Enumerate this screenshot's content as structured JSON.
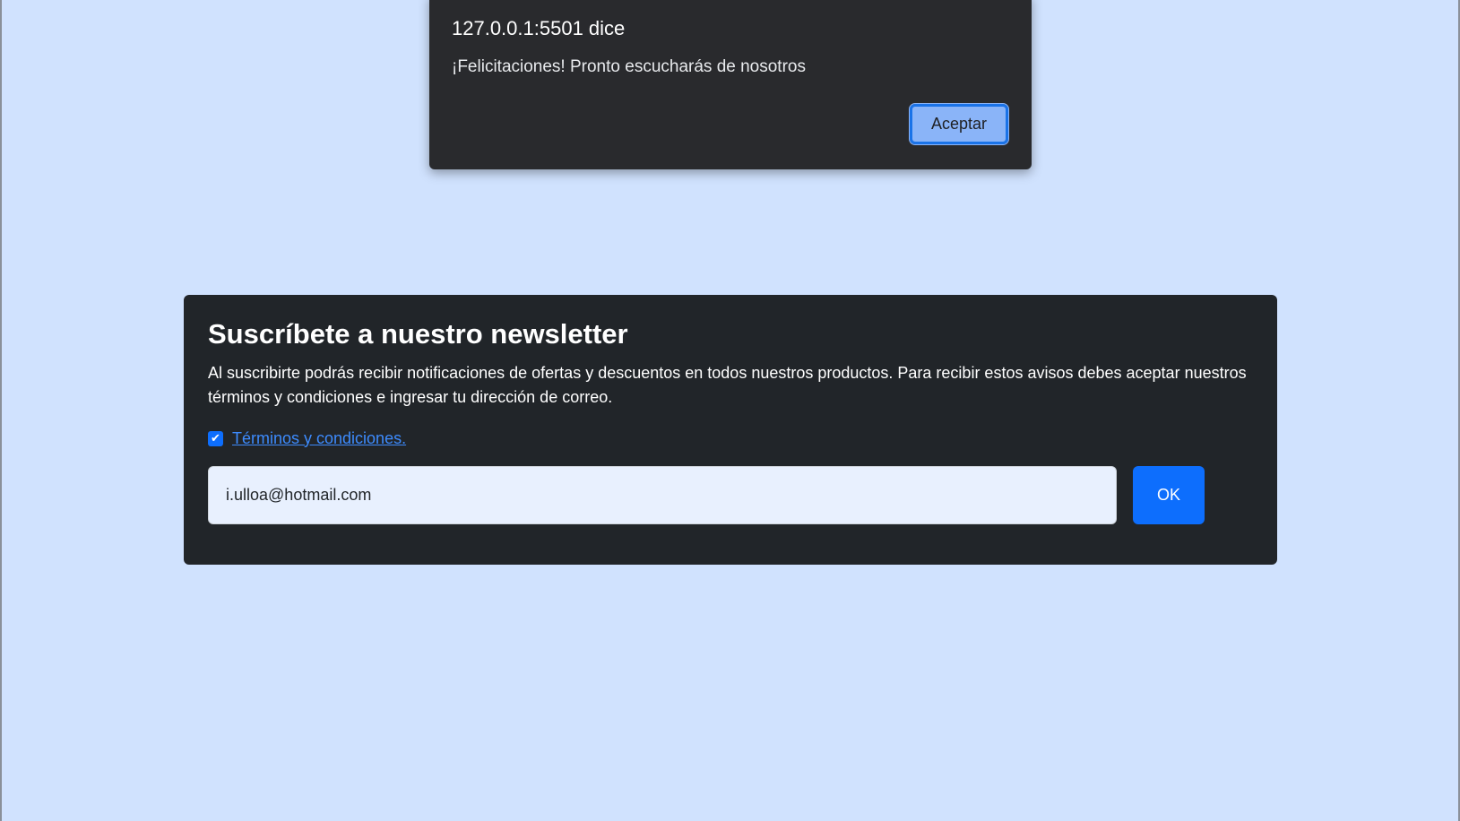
{
  "alert": {
    "title": "127.0.0.1:5501 dice",
    "message": "¡Felicitaciones! Pronto escucharás de nosotros",
    "button_label": "Aceptar"
  },
  "newsletter": {
    "title": "Suscríbete a nuestro newsletter",
    "description": "Al suscribirte podrás recibir notificaciones de ofertas y descuentos en todos nuestros productos. Para recibir estos avisos debes aceptar nuestros términos y condiciones e ingresar tu dirección de correo.",
    "terms_checked": true,
    "terms_link": "Términos y condiciones.",
    "email_value": "i.ulloa@hotmail.com",
    "submit_label": "OK"
  },
  "colors": {
    "page_background": "#d0e2fe",
    "card_background": "#212529",
    "dialog_background": "#292a2d",
    "primary": "#0d6efd",
    "dialog_button": "#8ab4f8"
  },
  "icons": {
    "checkbox": "check-icon"
  }
}
